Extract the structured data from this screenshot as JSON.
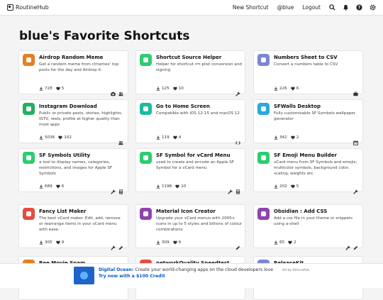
{
  "nav": {
    "brand": "RoutineHub",
    "links": [
      "New Shortcut",
      "@blue",
      "Logout"
    ],
    "icons": [
      "search-icon",
      "bell-icon",
      "help-icon",
      "settings-icon"
    ]
  },
  "page_title": "blue's Favorite Shortcuts",
  "cards": [
    {
      "name": "Airdrop Random Meme",
      "desc": "Get a random meme from r/memes' top posts for the day and Airdrop it.",
      "downloads": "728",
      "hearts": "5",
      "icon_color": "#e67e22",
      "actions": [
        "camera-icon",
        "users-icon"
      ]
    },
    {
      "name": "Shortcut Source Helper",
      "desc": "Helper for shortcut ⟺ plist conversion and signing",
      "downloads": "125",
      "hearts": "10",
      "icon_color": "#2ecc71",
      "actions": [
        "wrench-icon"
      ]
    },
    {
      "name": "Numbers Sheet to CSV",
      "desc": "Convert a numbers table to CSV",
      "downloads": "226",
      "hearts": "6",
      "icon_color": "#7b86d6",
      "actions": [
        "briefcase-icon"
      ]
    },
    {
      "name": "Instagram Download",
      "desc": "Public or private posts, stories, highlights, IGTV, reels, profile at higher quality than most apps",
      "downloads": "5036",
      "hearts": "102",
      "icon_color": "#27ae60",
      "actions": [
        "users-icon"
      ]
    },
    {
      "name": "Go to Home Screen",
      "desc": "Compatible with iOS 12-15 and macOS 12",
      "downloads": "119",
      "hearts": "4",
      "icon_color": "#1abc9c",
      "actions": [
        "code-icon"
      ]
    },
    {
      "name": "SFWalls Desktop",
      "desc": "Fully customisable SF Symbols wallpaper generator",
      "downloads": "342",
      "hearts": "2",
      "icon_color": "#29a8e0",
      "actions": [
        "calendar-icon"
      ]
    },
    {
      "name": "SF Symbols Utility",
      "desc": "a tool to display names, categories, restrictions, and images for Apple SF Symbols",
      "downloads": "689",
      "hearts": "6",
      "icon_color": "#2ecc71",
      "actions": [
        "wrench-icon",
        "calculator-icon"
      ]
    },
    {
      "name": "SF Symbol for vCard Menu",
      "desc": "used to create and encode an Apple SF Symbol for a vCard menu",
      "downloads": "1198",
      "hearts": "10",
      "icon_color": "#2ecc71",
      "actions": [
        "wrench-icon",
        "calculator-icon"
      ]
    },
    {
      "name": "SF Emoji Menu Builder",
      "desc": "vCard menu from SF Symbols and emojis; multicolor symbols, background color, scaling, weights etc.",
      "downloads": "202",
      "hearts": "5",
      "icon_color": "#2ecc71",
      "actions": [
        "wrench-icon"
      ]
    },
    {
      "name": "Fancy List Maker",
      "desc": "The best vCard maker. Edit, add, remove or rearrange items in your vCard menu with ease.",
      "downloads": "305",
      "hearts": "9",
      "icon_color": "#e74c3c",
      "actions": [
        "wrench-icon",
        "pen-icon"
      ]
    },
    {
      "name": "Material Icon Creator",
      "desc": "Upgrade your vCard menus with 2000+ icons in up to 5 styles and billions of colour combinations",
      "downloads": "309",
      "hearts": "6",
      "icon_color": "#8e44ad",
      "actions": [
        "pen-icon"
      ]
    },
    {
      "name": "Obsidian : Add CSS",
      "desc": "Add a css file in your theme or snippets using a-shell",
      "downloads": "65",
      "hearts": "2",
      "icon_color": "#8e44ad",
      "actions": [
        "wrench-icon",
        "pen-icon"
      ]
    },
    {
      "name": "Bee Movie Spam",
      "desc": "",
      "downloads": "",
      "hearts": "",
      "icon_color": "#e67e22",
      "actions": []
    },
    {
      "name": "networkQuality Speedtest",
      "desc": "",
      "downloads": "",
      "hearts": "",
      "icon_color": "#e74c3c",
      "actions": []
    },
    {
      "name": "ReleaseKit",
      "desc": "",
      "downloads": "",
      "hearts": "",
      "icon_color": "#7b86d6",
      "actions": []
    }
  ],
  "ad": {
    "brand": "Digital Ocean:",
    "text": "Create your world-changing apps on the cloud developers love",
    "cta": "Try now with a $100 Credit",
    "by": "Ad by EthicalAds"
  }
}
